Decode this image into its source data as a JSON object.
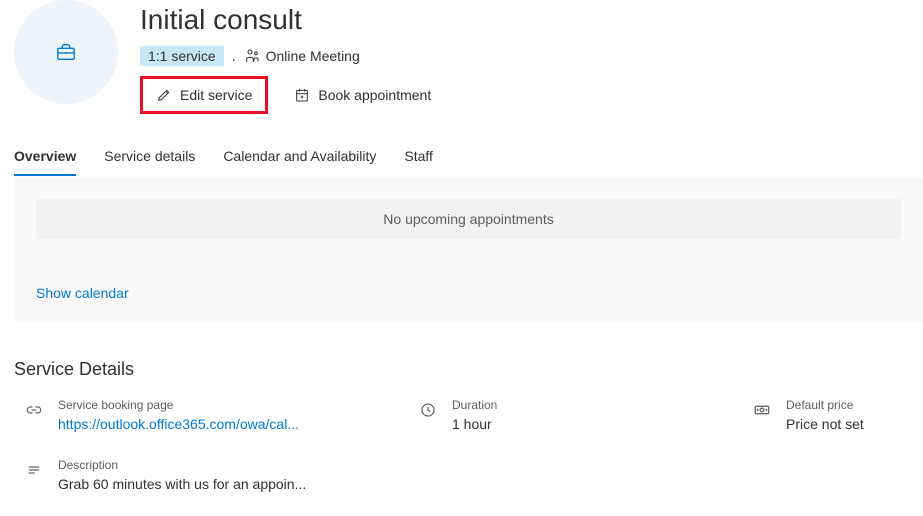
{
  "header": {
    "title": "Initial consult",
    "badge": "1:1 service",
    "meeting_type": "Online Meeting",
    "edit_label": "Edit service",
    "book_label": "Book appointment"
  },
  "tabs": [
    {
      "label": "Overview",
      "active": true
    },
    {
      "label": "Service details",
      "active": false
    },
    {
      "label": "Calendar and Availability",
      "active": false
    },
    {
      "label": "Staff",
      "active": false
    }
  ],
  "appointments": {
    "empty_message": "No upcoming appointments",
    "show_calendar": "Show calendar"
  },
  "service_details": {
    "heading": "Service Details",
    "booking_page": {
      "label": "Service booking page",
      "url": "https://outlook.office365.com/owa/cal..."
    },
    "duration": {
      "label": "Duration",
      "value": "1 hour"
    },
    "default_price": {
      "label": "Default price",
      "value": "Price not set"
    },
    "description": {
      "label": "Description",
      "value": "Grab 60 minutes with us for an appoin..."
    }
  }
}
